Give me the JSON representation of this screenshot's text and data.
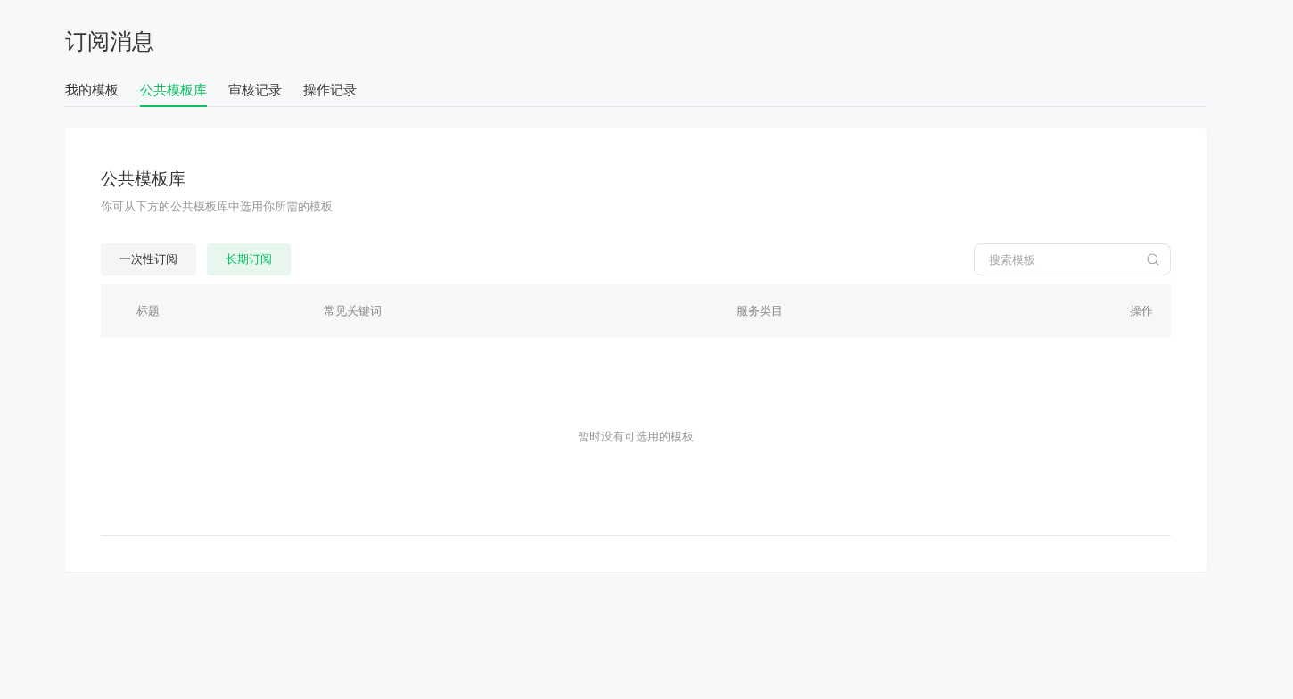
{
  "page": {
    "title": "订阅消息"
  },
  "tabs": [
    {
      "label": "我的模板",
      "selected": false
    },
    {
      "label": "公共模板库",
      "selected": true
    },
    {
      "label": "审核记录",
      "selected": false
    },
    {
      "label": "操作记录",
      "selected": false
    }
  ],
  "panel": {
    "title": "公共模板库",
    "description": "你可从下方的公共模板库中选用你所需的模板",
    "filters": [
      {
        "label": "一次性订阅",
        "selected": false
      },
      {
        "label": "长期订阅",
        "selected": true
      }
    ],
    "search": {
      "placeholder": "搜索模板"
    },
    "table": {
      "columns": [
        "标题",
        "常见关键词",
        "服务类目",
        "操作"
      ],
      "empty_text": "暂时没有可选用的模板"
    }
  }
}
